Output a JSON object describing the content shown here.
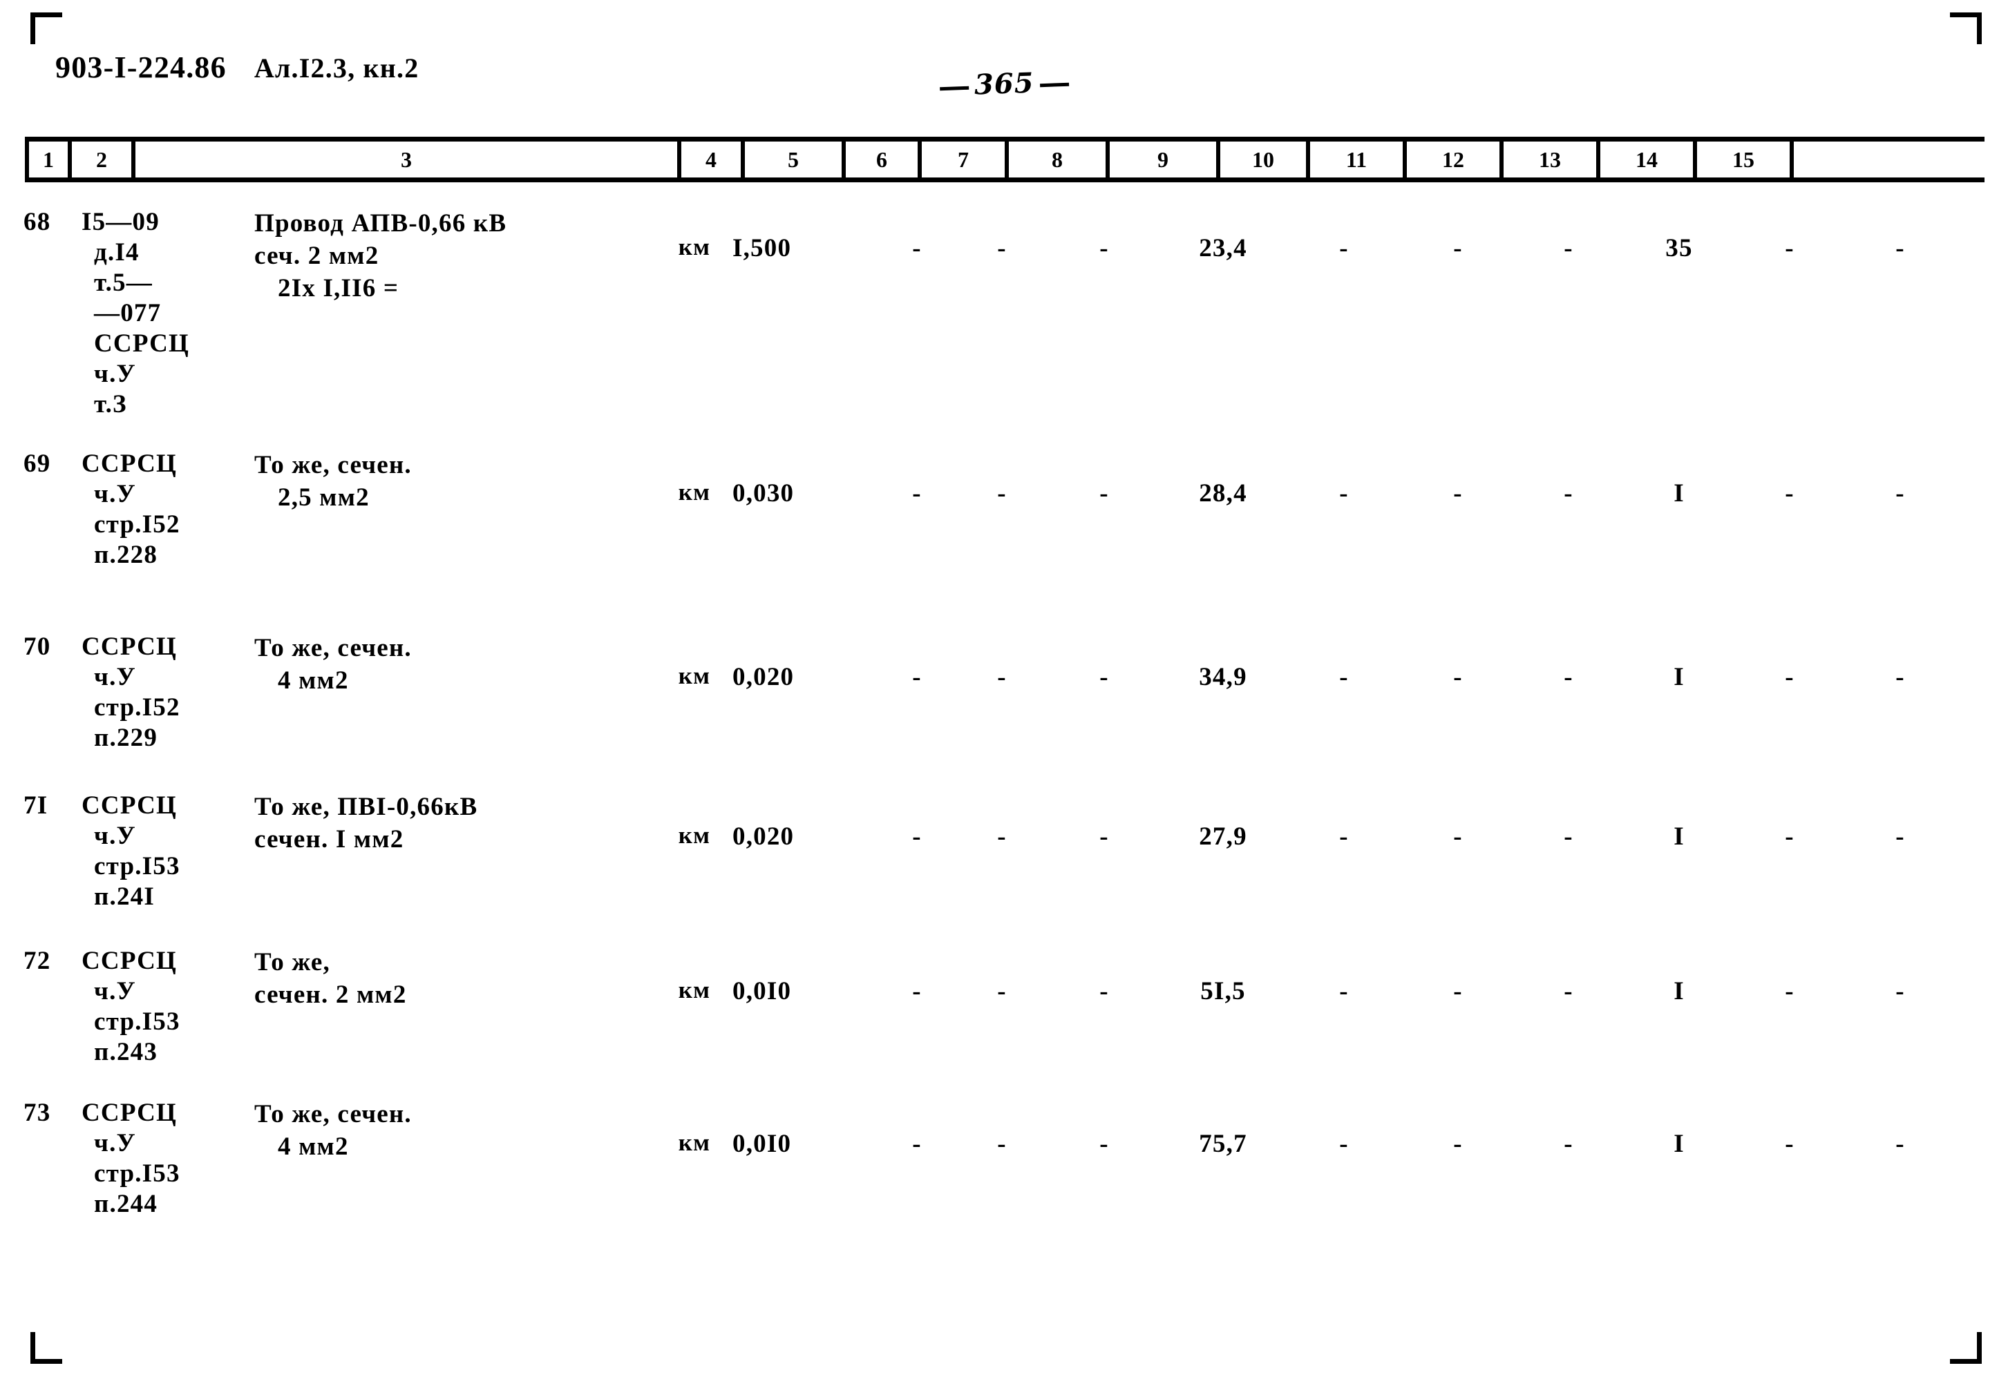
{
  "document": {
    "code": "903-I-224.86",
    "album": "Ал.I2.3, кн.2",
    "page_number": "365"
  },
  "table": {
    "column_headers": [
      "1",
      "2",
      "3",
      "4",
      "5",
      "6",
      "7",
      "8",
      "9",
      "10",
      "11",
      "12",
      "13",
      "14",
      "15"
    ],
    "rows": [
      {
        "num": "68",
        "ref_lines": [
          "I5—09",
          "д.I4",
          "т.5—",
          "—077",
          "ССРСЦ",
          "ч.У",
          "т.З"
        ],
        "desc_lines": [
          "Провод АПВ-0,66 кВ",
          "сеч. 2 мм2",
          "2Iх I,II6 ="
        ],
        "unit": "км",
        "c5": "I,500",
        "c6": "-",
        "c7": "-",
        "c8": "-",
        "c9": "23,4",
        "c10": "-",
        "c11": "-",
        "c12": "-",
        "c13": "35",
        "c14": "-",
        "c15": "-"
      },
      {
        "num": "69",
        "ref_lines": [
          "ССРСЦ",
          "ч.У",
          "стр.I52",
          "п.228"
        ],
        "desc_lines": [
          "То же, сечен.",
          "2,5 мм2"
        ],
        "unit": "км",
        "c5": "0,030",
        "c6": "-",
        "c7": "-",
        "c8": "-",
        "c9": "28,4",
        "c10": "-",
        "c11": "-",
        "c12": "-",
        "c13": "I",
        "c14": "-",
        "c15": "-"
      },
      {
        "num": "70",
        "ref_lines": [
          "ССРСЦ",
          "ч.У",
          "стр.I52",
          "п.229"
        ],
        "desc_lines": [
          "То же, сечен.",
          "4 мм2"
        ],
        "unit": "км",
        "c5": "0,020",
        "c6": "-",
        "c7": "-",
        "c8": "-",
        "c9": "34,9",
        "c10": "-",
        "c11": "-",
        "c12": "-",
        "c13": "I",
        "c14": "-",
        "c15": "-"
      },
      {
        "num": "7I",
        "ref_lines": [
          "ССРСЦ",
          "ч.У",
          "стр.I53",
          "п.24I"
        ],
        "desc_lines": [
          "То же, ПВI-0,66кВ",
          "сечен. I мм2"
        ],
        "unit": "км",
        "c5": "0,020",
        "c6": "-",
        "c7": "-",
        "c8": "-",
        "c9": "27,9",
        "c10": "-",
        "c11": "-",
        "c12": "-",
        "c13": "I",
        "c14": "-",
        "c15": "-"
      },
      {
        "num": "72",
        "ref_lines": [
          "ССРСЦ",
          "ч.У",
          "стр.I53",
          "п.243"
        ],
        "desc_lines": [
          "То же,",
          "сечен. 2 мм2"
        ],
        "unit": "км",
        "c5": "0,0I0",
        "c6": "-",
        "c7": "-",
        "c8": "-",
        "c9": "5I,5",
        "c10": "-",
        "c11": "-",
        "c12": "-",
        "c13": "I",
        "c14": "-",
        "c15": "-"
      },
      {
        "num": "73",
        "ref_lines": [
          "ССРСЦ",
          "ч.У",
          "стр.I53",
          "п.244"
        ],
        "desc_lines": [
          "То же, сечен.",
          "4 мм2"
        ],
        "unit": "км",
        "c5": "0,0I0",
        "c6": "-",
        "c7": "-",
        "c8": "-",
        "c9": "75,7",
        "c10": "-",
        "c11": "-",
        "c12": "-",
        "c13": "I",
        "c14": "-",
        "c15": "-"
      }
    ]
  }
}
